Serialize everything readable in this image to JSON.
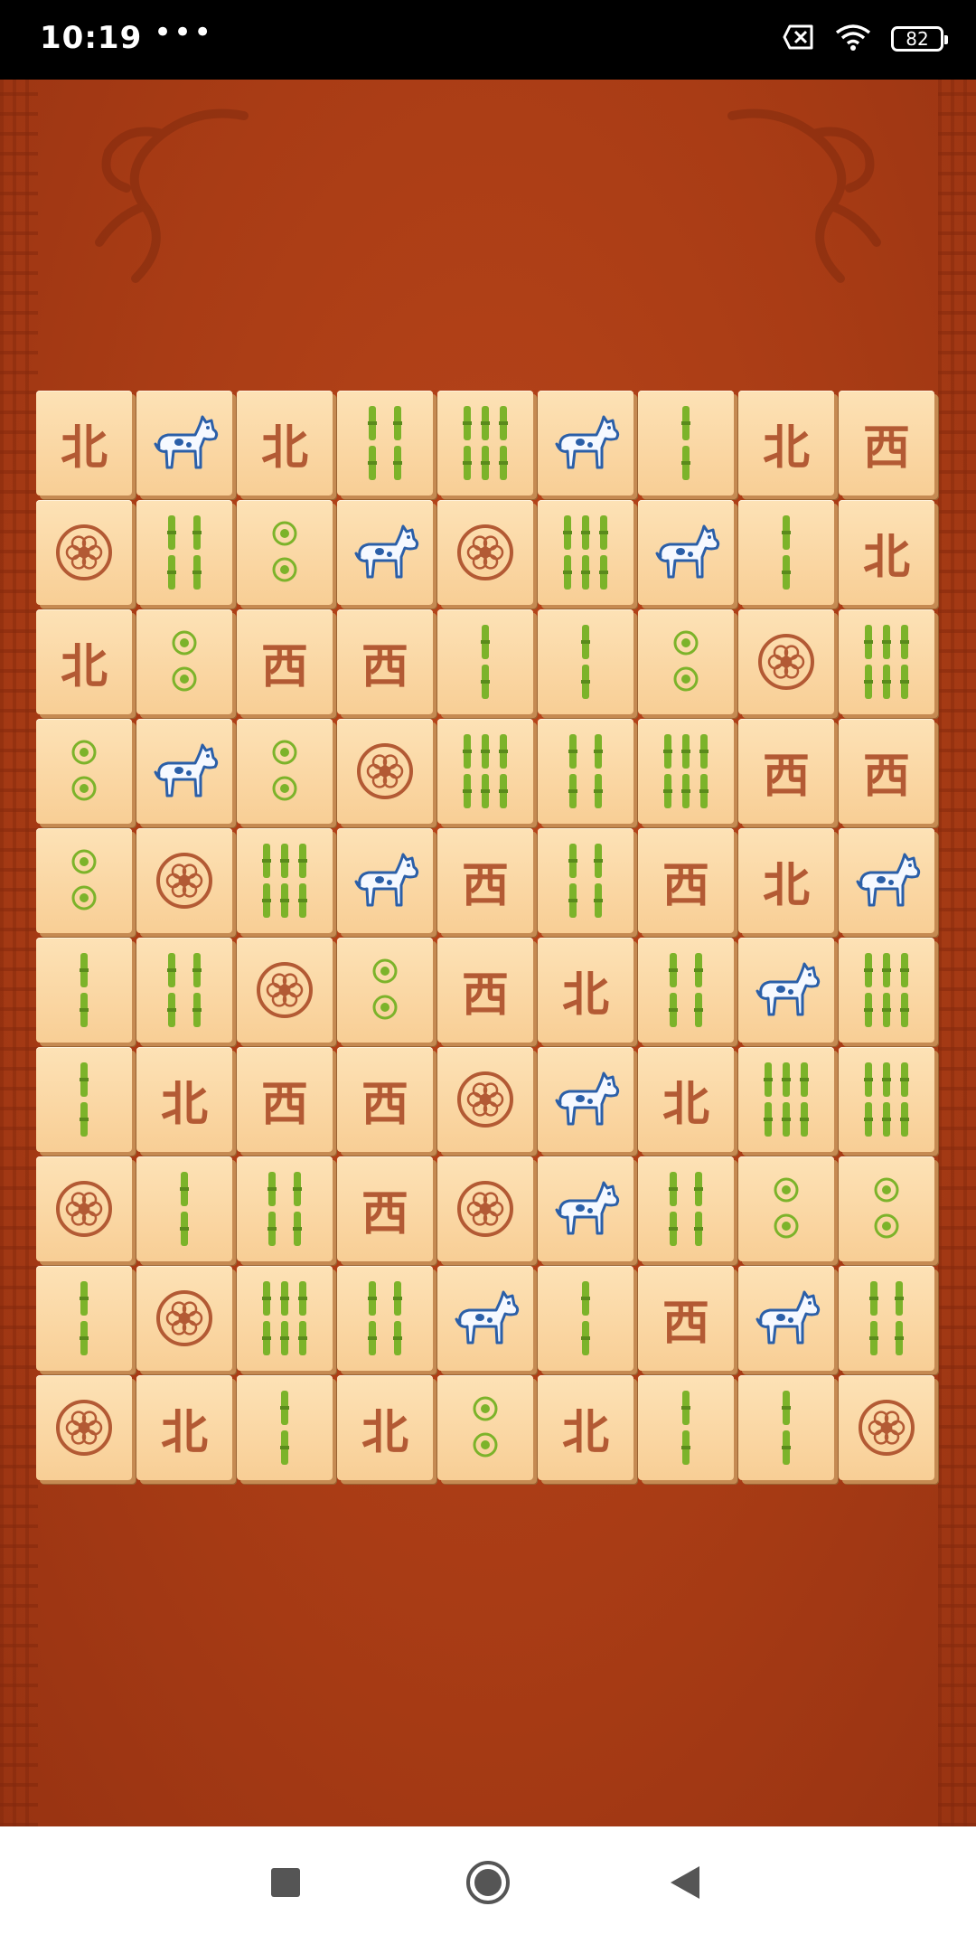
{
  "status_bar": {
    "time": "10:19",
    "dots": "•••",
    "battery": "82"
  },
  "board": {
    "rows": [
      [
        "bei",
        "dog",
        "bei",
        "bamboo4",
        "bamboo6",
        "dog",
        "bamboo2",
        "bei",
        "xi"
      ],
      [
        "flower",
        "bamboo4",
        "circle2",
        "dog",
        "flower",
        "bamboo6",
        "dog",
        "bamboo2",
        "bei"
      ],
      [
        "bei",
        "circle2",
        "xi",
        "xi",
        "bamboo2",
        "bamboo2",
        "circle2",
        "flower",
        "bamboo6"
      ],
      [
        "circle2",
        "dog",
        "circle2",
        "flower",
        "bamboo6",
        "bamboo4",
        "bamboo6",
        "xi",
        "xi"
      ],
      [
        "circle2",
        "flower",
        "bamboo6",
        "dog",
        "xi",
        "bamboo4",
        "xi",
        "bei",
        "dog"
      ],
      [
        "bamboo2",
        "bamboo4",
        "flower",
        "circle2",
        "xi",
        "bei",
        "bamboo4",
        "dog",
        "bamboo6"
      ],
      [
        "bamboo2",
        "bei",
        "xi",
        "xi",
        "flower",
        "dog",
        "bei",
        "bamboo6",
        "bamboo6"
      ],
      [
        "flower",
        "bamboo2",
        "bamboo4",
        "xi",
        "flower",
        "dog",
        "bamboo4",
        "circle2",
        "circle2"
      ],
      [
        "bamboo2",
        "flower",
        "bamboo6",
        "bamboo4",
        "dog",
        "bamboo2",
        "xi",
        "dog",
        "bamboo4"
      ],
      [
        "flower",
        "bei",
        "bamboo2",
        "bei",
        "circle2",
        "bei",
        "bamboo2",
        "bamboo2",
        "flower"
      ]
    ],
    "glyphs": {
      "bei": "北",
      "xi": "西"
    }
  },
  "colors": {
    "background": "#a93c15",
    "tile_face": "#fbd8a4",
    "char_red": "#b35a34",
    "bamboo_green": "#7cb32a",
    "dog_blue": "#2b5fa8"
  }
}
